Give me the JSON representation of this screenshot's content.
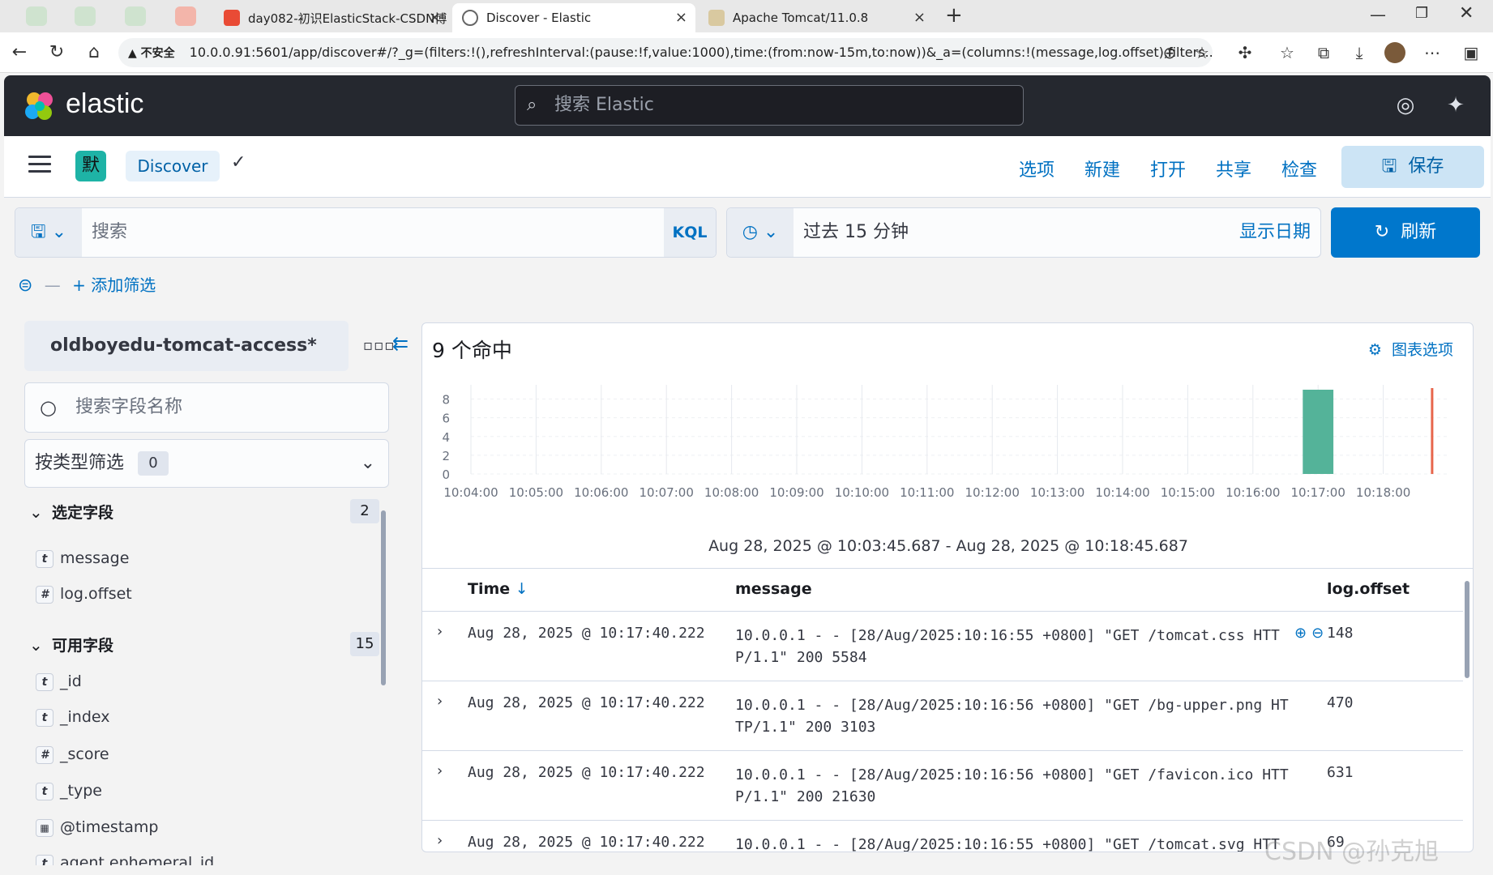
{
  "browser": {
    "tabs": [
      {
        "title": "day082-初识ElasticStack-CSDN博"
      },
      {
        "title": "Discover - Elastic"
      },
      {
        "title": "Apache Tomcat/11.0.8"
      }
    ],
    "url_warning": "不安全",
    "url": "10.0.0.91:5601/app/discover#/?_g=(filters:!(),refreshInterval:(pause:!f,value:1000),time:(from:now-15m,to:now))&_a=(columns:!(message,log.offset),filters..."
  },
  "header": {
    "brand": "elastic",
    "search_placeholder": "搜索 Elastic"
  },
  "appnav": {
    "space_initial": "默",
    "breadcrumb": "Discover",
    "menu": [
      "选项",
      "新建",
      "打开",
      "共享",
      "检查"
    ],
    "save_label": "保存"
  },
  "querybar": {
    "placeholder": "搜索",
    "language": "KQL",
    "time_label": "过去 15 分钟",
    "show_dates": "显示日期",
    "refresh_label": "刷新",
    "add_filter": "+ 添加筛选"
  },
  "sidebar": {
    "index_pattern": "oldboyedu-tomcat-access*",
    "field_search_placeholder": "搜索字段名称",
    "type_filter_label": "按类型筛选",
    "type_filter_count": "0",
    "selected": {
      "title": "选定字段",
      "count": "2",
      "fields": [
        {
          "type": "t",
          "name": "message"
        },
        {
          "type": "#",
          "name": "log.offset"
        }
      ]
    },
    "available": {
      "title": "可用字段",
      "count": "15",
      "fields": [
        {
          "type": "t",
          "name": "_id"
        },
        {
          "type": "t",
          "name": "_index"
        },
        {
          "type": "#",
          "name": "_score"
        },
        {
          "type": "t",
          "name": "_type"
        },
        {
          "type": "date",
          "name": "@timestamp"
        },
        {
          "type": "t",
          "name": "agent.ephemeral_id"
        }
      ]
    }
  },
  "main": {
    "hits": "9 个命中",
    "chart_options": "图表选项",
    "date_range": "Aug 28, 2025 @ 10:03:45.687 - Aug 28, 2025 @ 10:18:45.687",
    "columns": [
      "Time",
      "message",
      "log.offset"
    ],
    "rows": [
      {
        "time": "Aug 28, 2025 @ 10:17:40.222",
        "message": "10.0.0.1 - - [28/Aug/2025:10:16:55 +0800] \"GET /tomcat.css HTTP/1.1\" 200 5584",
        "offset": "148"
      },
      {
        "time": "Aug 28, 2025 @ 10:17:40.222",
        "message": "10.0.0.1 - - [28/Aug/2025:10:16:56 +0800] \"GET /bg-upper.png HTTP/1.1\" 200 3103",
        "offset": "470"
      },
      {
        "time": "Aug 28, 2025 @ 10:17:40.222",
        "message": "10.0.0.1 - - [28/Aug/2025:10:16:56 +0800] \"GET /favicon.ico HTTP/1.1\" 200 21630",
        "offset": "631"
      },
      {
        "time": "Aug 28, 2025 @ 10:17:40.222",
        "message": "10.0.0.1 - - [28/Aug/2025:10:16:55 +0800] \"GET /tomcat.svg HTT",
        "offset": "69"
      }
    ]
  },
  "watermark": "CSDN @孙克旭",
  "chart_data": {
    "type": "bar",
    "categories": [
      "10:04:00",
      "10:05:00",
      "10:06:00",
      "10:07:00",
      "10:08:00",
      "10:09:00",
      "10:10:00",
      "10:11:00",
      "10:12:00",
      "10:13:00",
      "10:14:00",
      "10:15:00",
      "10:16:00",
      "10:17:00",
      "10:18:00"
    ],
    "values": [
      0,
      0,
      0,
      0,
      0,
      0,
      0,
      0,
      0,
      0,
      0,
      0,
      0,
      9,
      0
    ],
    "yticks": [
      0,
      2,
      4,
      6,
      8
    ],
    "ylim": [
      0,
      9
    ],
    "bar_color": "#54b399",
    "now_marker_color": "#e7664c",
    "grid": true
  }
}
